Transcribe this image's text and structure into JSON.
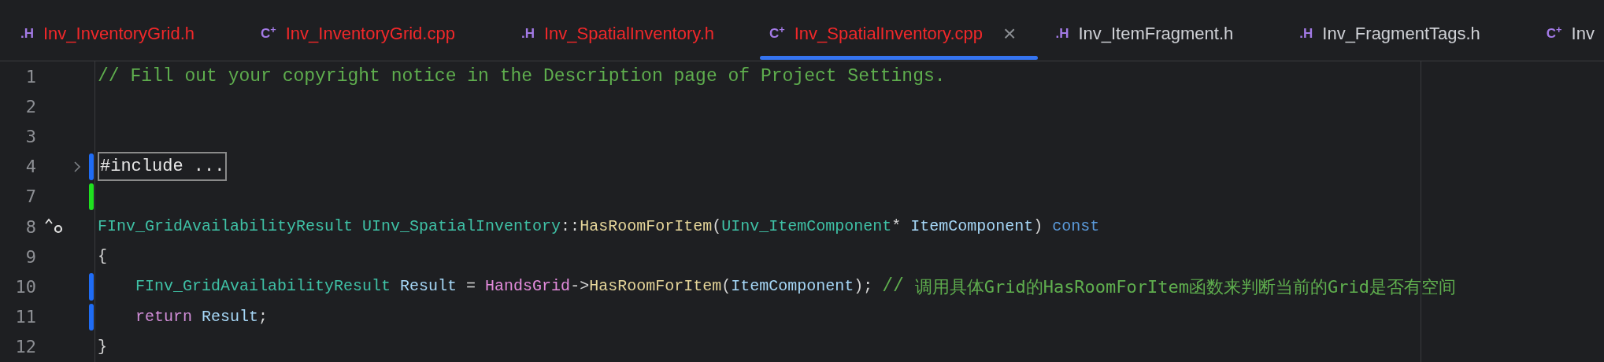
{
  "tabs": [
    {
      "badge": ".H",
      "label": "Inv_InventoryGrid.h",
      "error": true,
      "selected": false
    },
    {
      "badge": "C$^{+}$",
      "label": "Inv_InventoryGrid.cpp",
      "error": true,
      "selected": false
    },
    {
      "badge": ".H",
      "label": "Inv_SpatialInventory.h",
      "error": true,
      "selected": false
    },
    {
      "badge": "C$^{+}$",
      "label": "Inv_SpatialInventory.cpp",
      "error": true,
      "selected": true,
      "close": "×"
    },
    {
      "badge": ".H",
      "label": "Inv_ItemFragment.h",
      "error": false,
      "selected": false
    },
    {
      "badge": ".H",
      "label": "Inv_FragmentTags.h",
      "error": false,
      "selected": false
    },
    {
      "badge": "C$^{+}$",
      "label": "Inv",
      "error": false,
      "selected": false
    }
  ],
  "editor": {
    "lines": [
      {
        "number": "1",
        "tokens": [
          {
            "kind": "comment",
            "text": "// Fill out your copyright notice in the Description page of Project Settings."
          }
        ]
      },
      {
        "number": "2"
      },
      {
        "number": "3"
      },
      {
        "number": "4",
        "modified": true,
        "fold": true,
        "tokens": [
          {
            "kind": "folded",
            "text": "#include ..."
          }
        ]
      },
      {
        "number": "7",
        "added": true
      },
      {
        "number": "8",
        "overridden": true,
        "tokens": [
          {
            "kind": "type",
            "text": "FInv_GridAvailabilityResult UInv_SpatialInventory"
          },
          {
            "kind": "plain",
            "text": "::"
          },
          {
            "kind": "function",
            "text": "HasRoomForItem"
          },
          {
            "kind": "plain",
            "text": "("
          },
          {
            "kind": "type",
            "text": "UInv_ItemComponent"
          },
          {
            "kind": "plain",
            "text": "* "
          },
          {
            "kind": "param",
            "text": "ItemComponent"
          },
          {
            "kind": "plain",
            "text": ") "
          },
          {
            "kind": "keyword",
            "text": "const"
          }
        ]
      },
      {
        "number": "9",
        "tokens": [
          {
            "kind": "plain",
            "text": "{"
          }
        ]
      },
      {
        "number": "10",
        "modified": true,
        "tokens": [
          {
            "kind": "type",
            "text": "    FInv_GridAvailabilityResult "
          },
          {
            "kind": "param",
            "text": "Result"
          },
          {
            "kind": "plain",
            "text": " = "
          },
          {
            "kind": "member",
            "text": "HandsGrid"
          },
          {
            "kind": "plain",
            "text": "->"
          },
          {
            "kind": "function",
            "text": "HasRoomForItem"
          },
          {
            "kind": "plain",
            "text": "("
          },
          {
            "kind": "param",
            "text": "ItemComponent"
          },
          {
            "kind": "plain",
            "text": "); "
          },
          {
            "kind": "comment",
            "text": "// "
          },
          {
            "kind": "comment-cjk",
            "text": "调用具体Grid的HasRoomForItem函数来判断当前的Grid是否有空间"
          }
        ]
      },
      {
        "number": "11",
        "modified": true,
        "tokens": [
          {
            "kind": "return",
            "text": "    return "
          },
          {
            "kind": "param",
            "text": "Result"
          },
          {
            "kind": "plain",
            "text": ";"
          }
        ]
      },
      {
        "number": "12",
        "tokens": [
          {
            "kind": "plain",
            "text": "}"
          }
        ]
      }
    ]
  }
}
